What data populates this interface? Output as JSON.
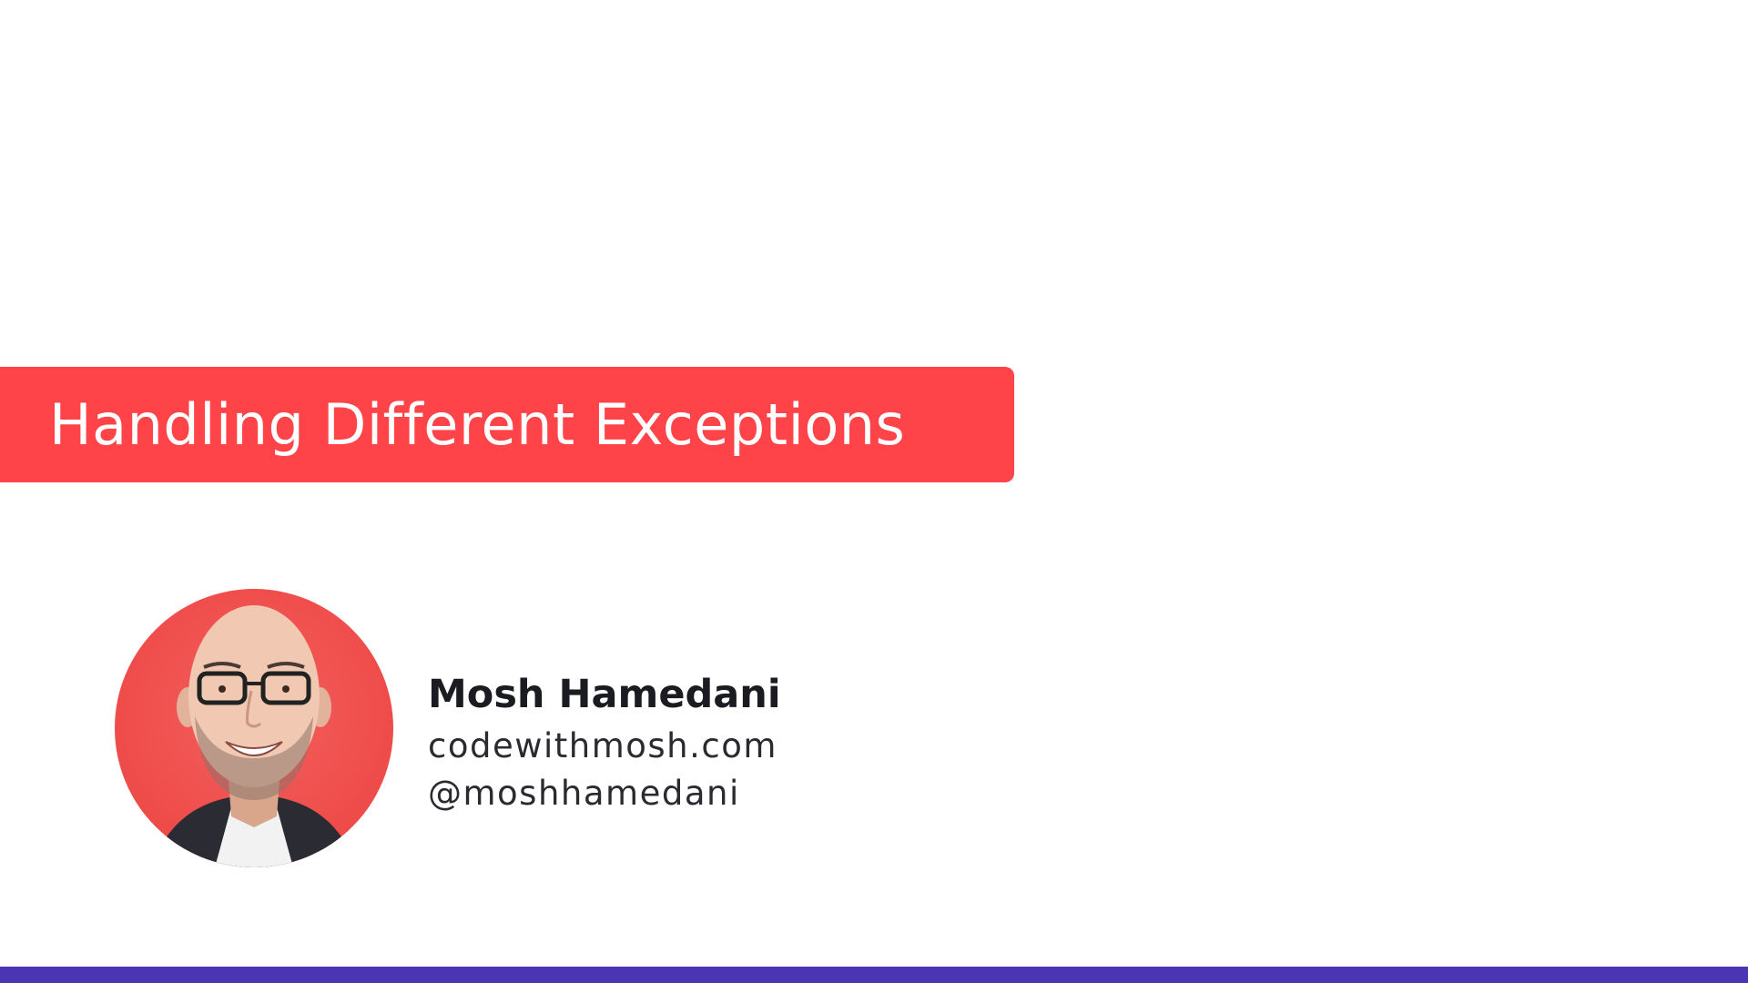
{
  "title": "Handling Different Exceptions",
  "author": {
    "name": "Mosh Hamedani",
    "website": "codewithmosh.com",
    "handle": "@moshhamedani",
    "avatar_icon": "portrait-photo"
  },
  "colors": {
    "banner": "#fe4448",
    "bottom_bar": "#4b35b3",
    "background": "#ffffff"
  }
}
